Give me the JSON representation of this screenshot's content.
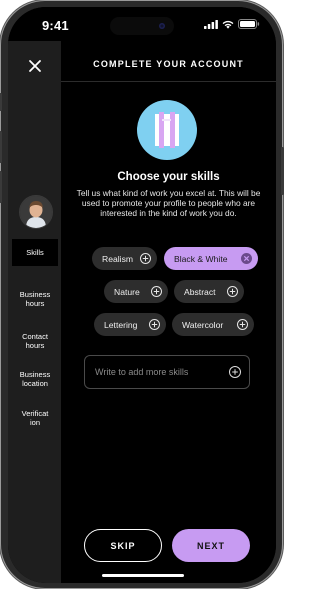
{
  "status_bar": {
    "time": "9:41"
  },
  "header": {
    "title": "COMPLETE YOUR ACCOUNT"
  },
  "sidebar": {
    "items": [
      {
        "label": "Skills",
        "active": true
      },
      {
        "label": "Business\nhours"
      },
      {
        "label": "Contact\nhours"
      },
      {
        "label": "Business\nlocation"
      },
      {
        "label": "Verificat\nion"
      }
    ]
  },
  "main": {
    "title": "Choose your skills",
    "description": "Tell us what kind of work you excel at. This will be used to promote your profile to people who are interested in the kind of work you do.",
    "skills": [
      {
        "label": "Realism",
        "selected": false
      },
      {
        "label": "Black & White",
        "selected": true
      },
      {
        "label": "Nature",
        "selected": false
      },
      {
        "label": "Abstract",
        "selected": false
      },
      {
        "label": "Lettering",
        "selected": false
      },
      {
        "label": "Watercolor",
        "selected": false
      }
    ],
    "add_skill": {
      "placeholder": "Write to add more skills"
    },
    "actions": {
      "skip_label": "SKIP",
      "next_label": "NEXT"
    }
  },
  "icons": [
    "close-icon",
    "signal-icon",
    "wifi-icon",
    "battery-icon",
    "skills-illustration-icon",
    "plus-icon",
    "remove-icon"
  ],
  "colors": {
    "accent": "#c79bf2",
    "icon_bg": "#7fd0f1",
    "background": "#000000",
    "sidebar": "#1e1e1e"
  }
}
